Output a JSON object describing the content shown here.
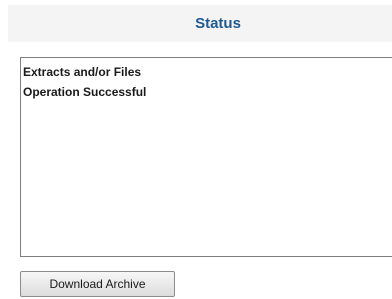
{
  "header": {
    "title": "Status"
  },
  "status_box": {
    "lines": [
      "Extracts and/or Files",
      "Operation Successful"
    ]
  },
  "actions": {
    "download_label": "Download Archive"
  },
  "colors": {
    "title": "#1f5a92",
    "header_background": "#f4f4f4",
    "box_border": "#7f7f7f"
  }
}
